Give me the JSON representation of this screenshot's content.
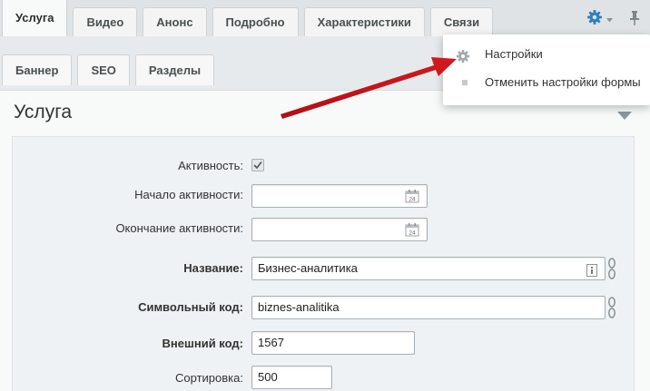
{
  "tabs_row1": [
    "Услуга",
    "Видео",
    "Анонс",
    "Подробно",
    "Характеристики",
    "Связи"
  ],
  "tabs_row2": [
    "Баннер",
    "SEO",
    "Разделы"
  ],
  "section_title": "Услуга",
  "menu": {
    "items": [
      "Настройки",
      "Отменить настройки формы"
    ]
  },
  "form": {
    "active_label": "Активность:",
    "active_from_label": "Начало активности:",
    "active_from_value": "",
    "active_to_label": "Окончание активности:",
    "active_to_value": "",
    "name_label": "Название:",
    "name_value": "Бизнес-аналитика",
    "code_label": "Символьный код:",
    "code_value": "biznes-analitika",
    "xml_id_label": "Внешний код:",
    "xml_id_value": "1567",
    "sort_label": "Сортировка:",
    "sort_value": "500"
  },
  "calendar_day": "24",
  "colors": {
    "accent_blue": "#2f7fc1",
    "arrow_red": "#c4141a"
  }
}
